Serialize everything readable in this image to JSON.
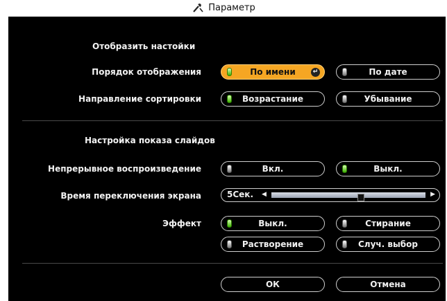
{
  "title": "Параметр",
  "title_icon": "tools-icon",
  "display_settings": {
    "heading": "Отобразить настойки",
    "order": {
      "label": "Порядок отображения",
      "by_name": "По имени",
      "by_date": "По дате",
      "selected": "by_name"
    },
    "sort": {
      "label": "Направление сортировки",
      "ascending": "Возрастание",
      "descending": "Убывание",
      "selected": "ascending"
    }
  },
  "slideshow": {
    "heading": "Настройка показа слайдов",
    "continuous": {
      "label": "Непрерывное воспроизведение",
      "on": "Вкл.",
      "off": "Выкл.",
      "selected": "off"
    },
    "switch_time": {
      "label": "Время переключения экрана",
      "value": "5",
      "unit": "Сек."
    },
    "effect": {
      "label": "Эффект",
      "off": "Выкл.",
      "wipe": "Стирание",
      "dissolve": "Растворение",
      "random": "Случ. выбор",
      "selected": "off"
    }
  },
  "buttons": {
    "ok": "ОК",
    "cancel": "Отмена"
  },
  "colors": {
    "focus": "#f5a623",
    "led_on": "#3cb000",
    "background": "#000000"
  }
}
